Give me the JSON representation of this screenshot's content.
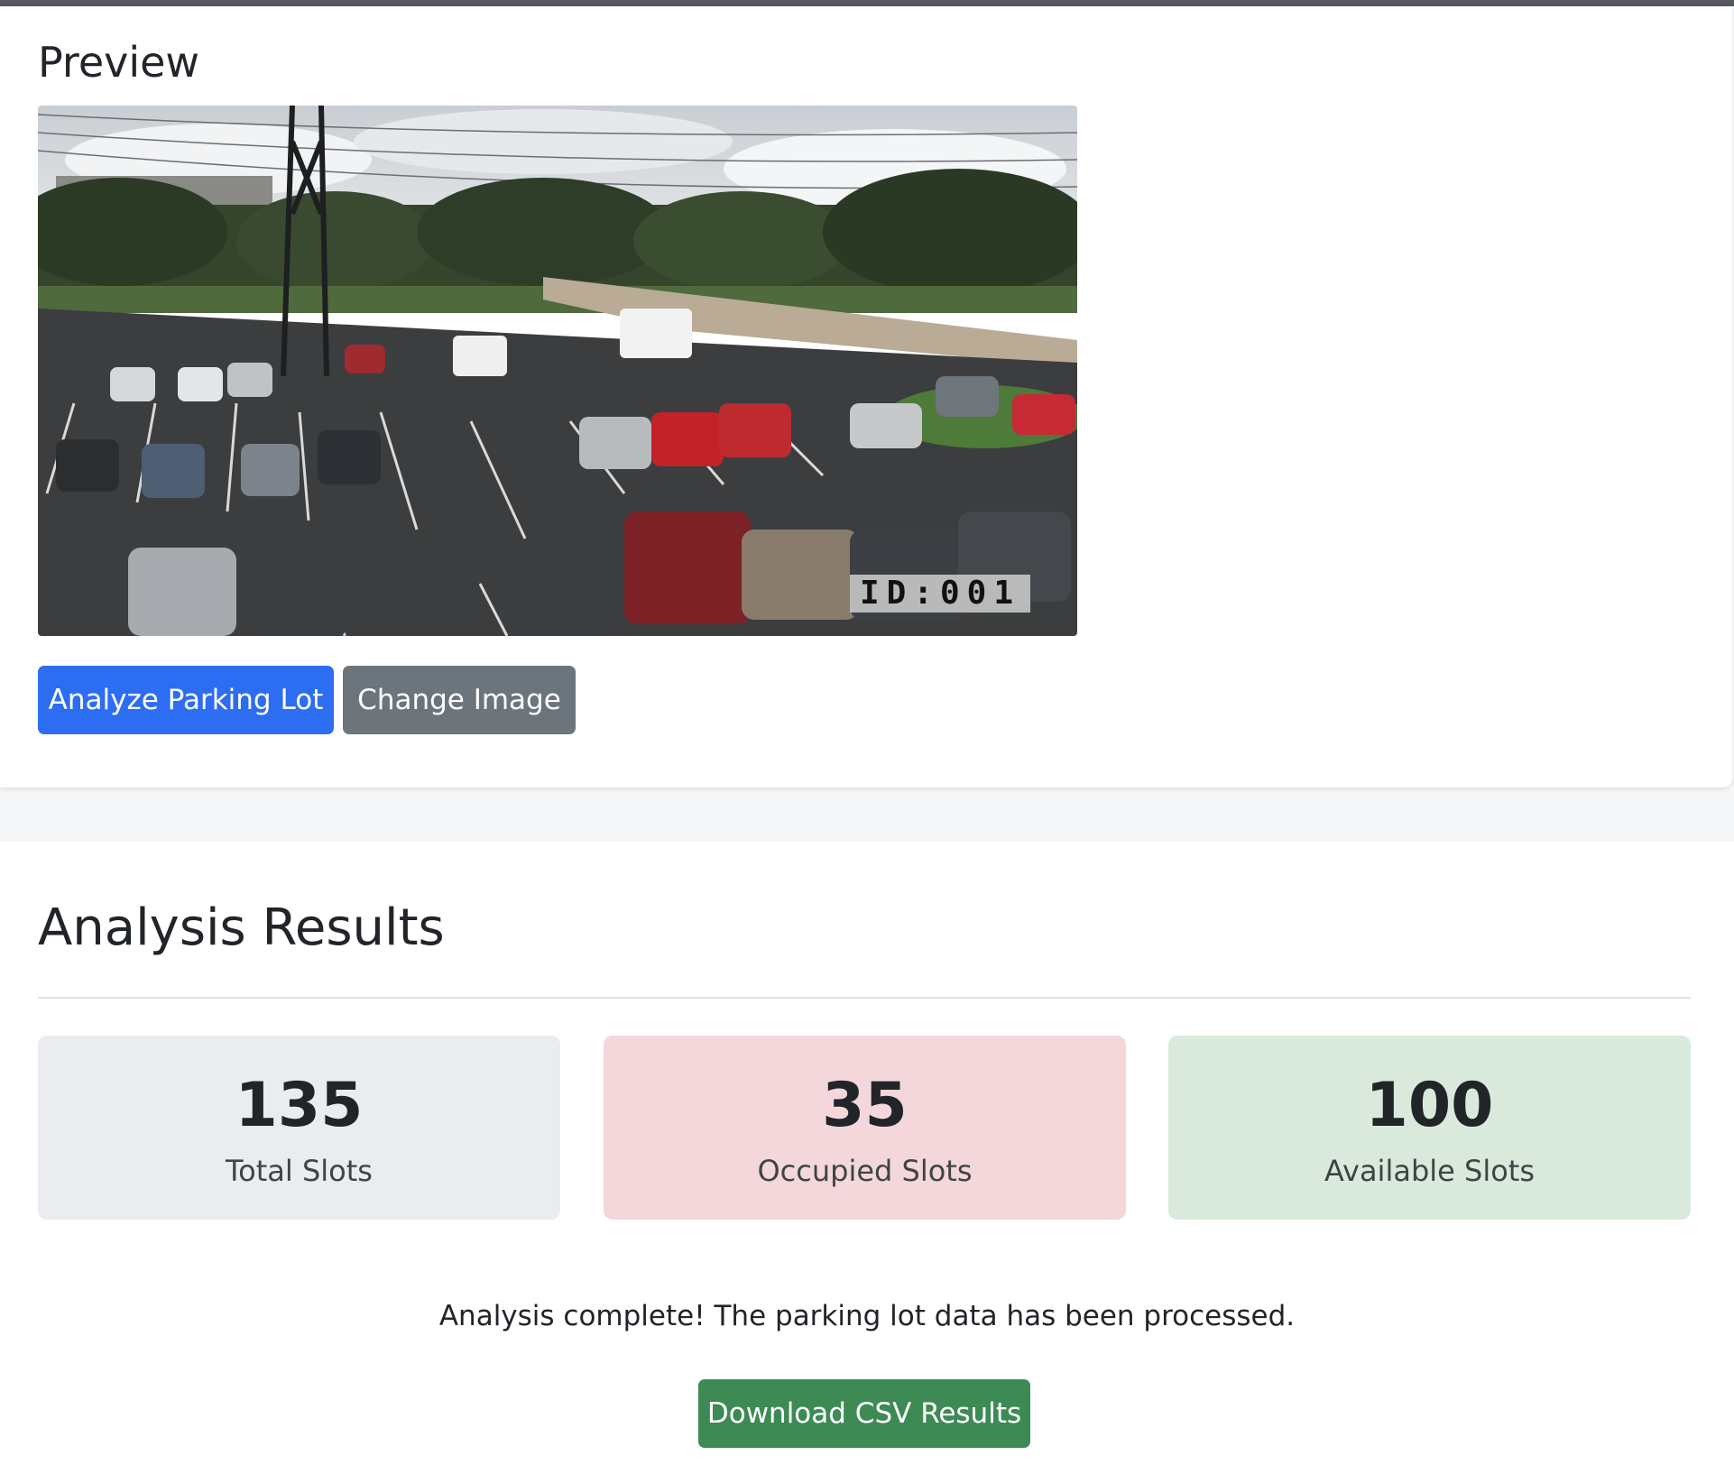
{
  "preview": {
    "title": "Preview",
    "image_overlay_text": "ID:001",
    "analyze_button": "Analyze Parking Lot",
    "change_button": "Change Image"
  },
  "results": {
    "title": "Analysis Results",
    "stats": {
      "total": {
        "value": "135",
        "label": "Total Slots"
      },
      "occupied": {
        "value": "35",
        "label": "Occupied Slots"
      },
      "available": {
        "value": "100",
        "label": "Available Slots"
      }
    },
    "message": "Analysis complete! The parking lot data has been processed.",
    "download_button": "Download CSV Results"
  },
  "colors": {
    "primary": "#2c6df1",
    "secondary": "#6c747c",
    "success": "#3d8a55",
    "total_bg": "#eaecef",
    "occupied_bg": "#f4d7da",
    "available_bg": "#d9eadc"
  }
}
